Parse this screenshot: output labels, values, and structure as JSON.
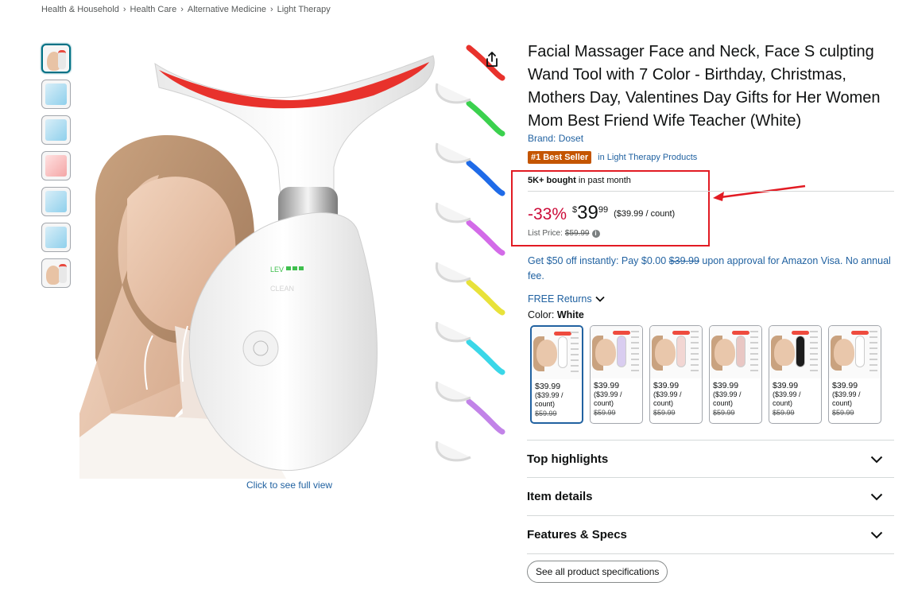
{
  "breadcrumb": [
    "Health & Household",
    "Health Care",
    "Alternative Medicine",
    "Light Therapy"
  ],
  "breadcrumb_separator": "›",
  "gallery": {
    "thumbnails": [
      "product-main",
      "product-blue",
      "product-angle",
      "product-pink",
      "product-blue-2",
      "product-demo",
      "product-lifestyle"
    ],
    "selected_index": 0,
    "click_full_view": "Click to see full view",
    "device_text": [
      "LEV",
      "CLEAN"
    ]
  },
  "product": {
    "title": "Facial Massager Face and Neck, Face S culpting Wand Tool with 7 Color - Birthday, Christmas, Mothers Day, Valentines Day Gifts for Her Women Mom Best Friend Wife Teacher (White)",
    "brand": "Brand: Doset",
    "bestseller_badge": "#1 Best Seller",
    "bestseller_category": "in Light Therapy Products"
  },
  "sales": {
    "bought_bold": "5K+ bought",
    "bought_rest": " in past month"
  },
  "price": {
    "discount": "-33%",
    "currency": "$",
    "whole": "39",
    "fraction": "99",
    "per_unit": "($39.99 / count)",
    "list_label": "List Price:",
    "list_value": "$59.99"
  },
  "promo": {
    "text_start": "Get $50 off instantly: Pay $0.00 ",
    "strike": "$39.99",
    "text_end": " upon approval for Amazon Visa. No annual fee."
  },
  "returns": "FREE Returns",
  "color": {
    "label": "Color: ",
    "value": "White",
    "swatches": [
      {
        "price": "$39.99",
        "unit": "($39.99 /",
        "unit2": "count)",
        "list": "$59.99",
        "body_color": "#ffffff"
      },
      {
        "price": "$39.99",
        "unit": "($39.99 /",
        "unit2": "count)",
        "list": "$59.99",
        "body_color": "#d9cdf0"
      },
      {
        "price": "$39.99",
        "unit": "($39.99 /",
        "unit2": "count)",
        "list": "$59.99",
        "body_color": "#f2d6d3"
      },
      {
        "price": "$39.99",
        "unit": "($39.99 /",
        "unit2": "count)",
        "list": "$59.99",
        "body_color": "#e9c7c4"
      },
      {
        "price": "$39.99",
        "unit": "($39.99 /",
        "unit2": "count)",
        "list": "$59.99",
        "body_color": "#1d1d1d"
      },
      {
        "price": "$39.99",
        "unit": "($39.99 /",
        "unit2": "count)",
        "list": "$59.99",
        "body_color": "#ffffff"
      }
    ]
  },
  "sections": {
    "highlights": "Top highlights",
    "item_details": "Item details",
    "features": "Features & Specs"
  },
  "see_all_specs": "See all product specifications",
  "colors": {
    "link": "#2162a1",
    "discount": "#cc0c39",
    "badge": "#c45500",
    "annotation": "#e21b23"
  }
}
